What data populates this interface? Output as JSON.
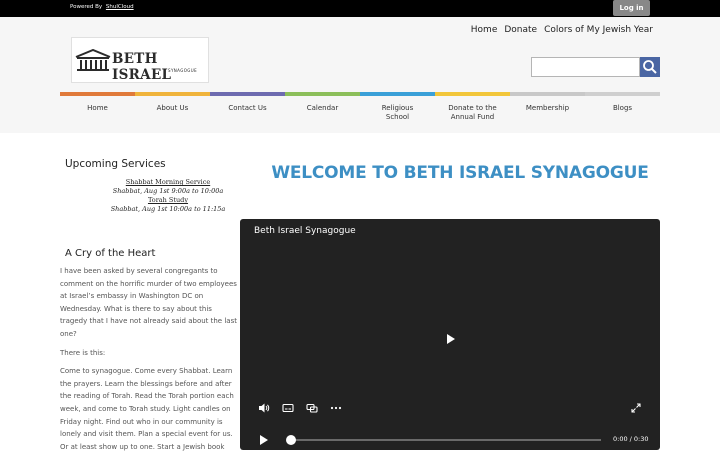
{
  "topbar": {
    "powered_by": "Powered By",
    "brand": "ShulCloud",
    "login_label": "Log in"
  },
  "header": {
    "links": [
      "Home",
      "Donate",
      "Colors of My Jewish Year"
    ],
    "logo": {
      "name": "BETH ISRAEL",
      "sub": "SYNAGOGUE"
    },
    "search": {
      "placeholder": "",
      "icon": "search-icon"
    },
    "color_bar": [
      "#e07a3a",
      "#f0b43c",
      "#6e6bb0",
      "#8cbf5a",
      "#3aa0d8",
      "#f2c63a",
      "#c8c8c8",
      "#cfcfcf"
    ]
  },
  "nav": [
    [
      "Home"
    ],
    [
      "About Us"
    ],
    [
      "Contact Us"
    ],
    [
      "Calendar"
    ],
    [
      "Religious",
      "School"
    ],
    [
      "Donate to the",
      "Annual Fund"
    ],
    [
      "Membership"
    ],
    [
      "Blogs"
    ]
  ],
  "services": {
    "title": "Upcoming Services",
    "items": [
      {
        "event": "Shabbat Morning Service",
        "when": "Shabbat, Aug 1st 9:00a to 10:00a"
      },
      {
        "event": "Torah Study",
        "when": "Shabbat, Aug 1st 10:00a to 11:15a"
      }
    ]
  },
  "welcome": "WELCOME TO BETH ISRAEL SYNAGOGUE",
  "post": {
    "title": "A Cry of the Heart",
    "paragraphs": [
      "I have been asked by several congregants to comment on the horrific murder of two employees at Israel’s embassy in Washington DC on Wednesday.   What is there to say about this tragedy that I have not already said about the last one?",
      "There is this:",
      "Come to synagogue.  Come every Shabbat.  Learn the prayers.  Learn the blessings before and after the reading of Torah.  Read the Torah portion each week, and come to Torah study.  Light candles on Friday night.  Find out who in our community is lonely and visit them.  Plan a special event for us.  Or at least show up to one.  Start a Jewish book"
    ]
  },
  "video": {
    "title": "Beth Israel Synagogue",
    "time": "0:00 / 0:30",
    "progress": 0,
    "controls": [
      "volume-icon",
      "captions-icon",
      "picture-in-picture-icon",
      "more-icon",
      "fullscreen-icon",
      "play-icon"
    ]
  }
}
